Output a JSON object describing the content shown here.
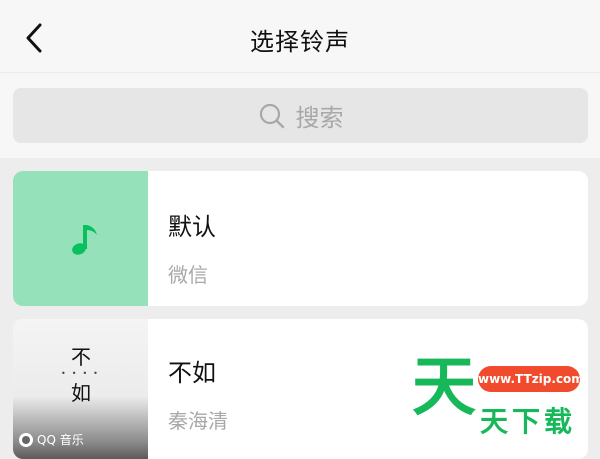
{
  "header": {
    "title": "选择铃声"
  },
  "search": {
    "placeholder": "搜索"
  },
  "ringtones": [
    {
      "name": "默认",
      "source": "微信"
    },
    {
      "name": "不如",
      "source": "秦海清",
      "cover_chars": [
        "不",
        "如"
      ],
      "cover_badge": "QQ 音乐"
    }
  ],
  "watermark": {
    "glyph": "天",
    "url": "www.TTzip.com",
    "text": "天下载"
  },
  "icons": {
    "back": "chevron-left-icon",
    "search": "search-icon",
    "music": "music-note-icon"
  },
  "colors": {
    "accent": "#07c160",
    "default_thumb": "#95e1b9"
  }
}
